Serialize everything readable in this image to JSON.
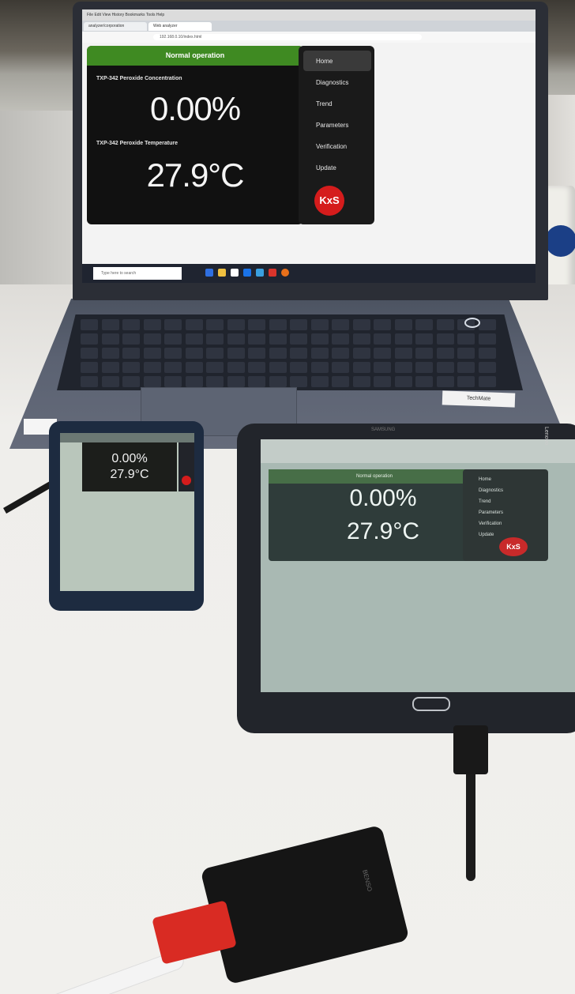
{
  "laptop": {
    "browser_menu": "File  Edit  View  History  Bookmarks  Tools  Help",
    "tab1": "analyzer/corporation",
    "tab2": "Web analyzer",
    "url": "192.168.0.10/index.html",
    "status": "Normal operation",
    "measurement1_label": "TXP-342 Peroxide Concentration",
    "measurement1_value": "0.00%",
    "measurement2_label": "TXP-342 Peroxide Temperature",
    "measurement2_value": "27.9°C",
    "nav_items": [
      "Home",
      "Diagnostics",
      "Trend",
      "Parameters",
      "Verification",
      "Update"
    ],
    "logo_text": "KxS",
    "search_placeholder": "Type here to search"
  },
  "phone": {
    "value1": "0.00%",
    "value2": "27.9°C"
  },
  "tablet": {
    "brand": "SAMSUNG",
    "status": "Normal operation",
    "value1": "0.00%",
    "value2": "27.9°C",
    "nav_items": [
      "Home",
      "Diagnostics",
      "Trend",
      "Parameters",
      "Verification",
      "Update"
    ],
    "logo_text": "KxS"
  },
  "laptop_brand": "Lenovo",
  "adapter_brand": "BENSO",
  "sticker_text": "TechMate"
}
